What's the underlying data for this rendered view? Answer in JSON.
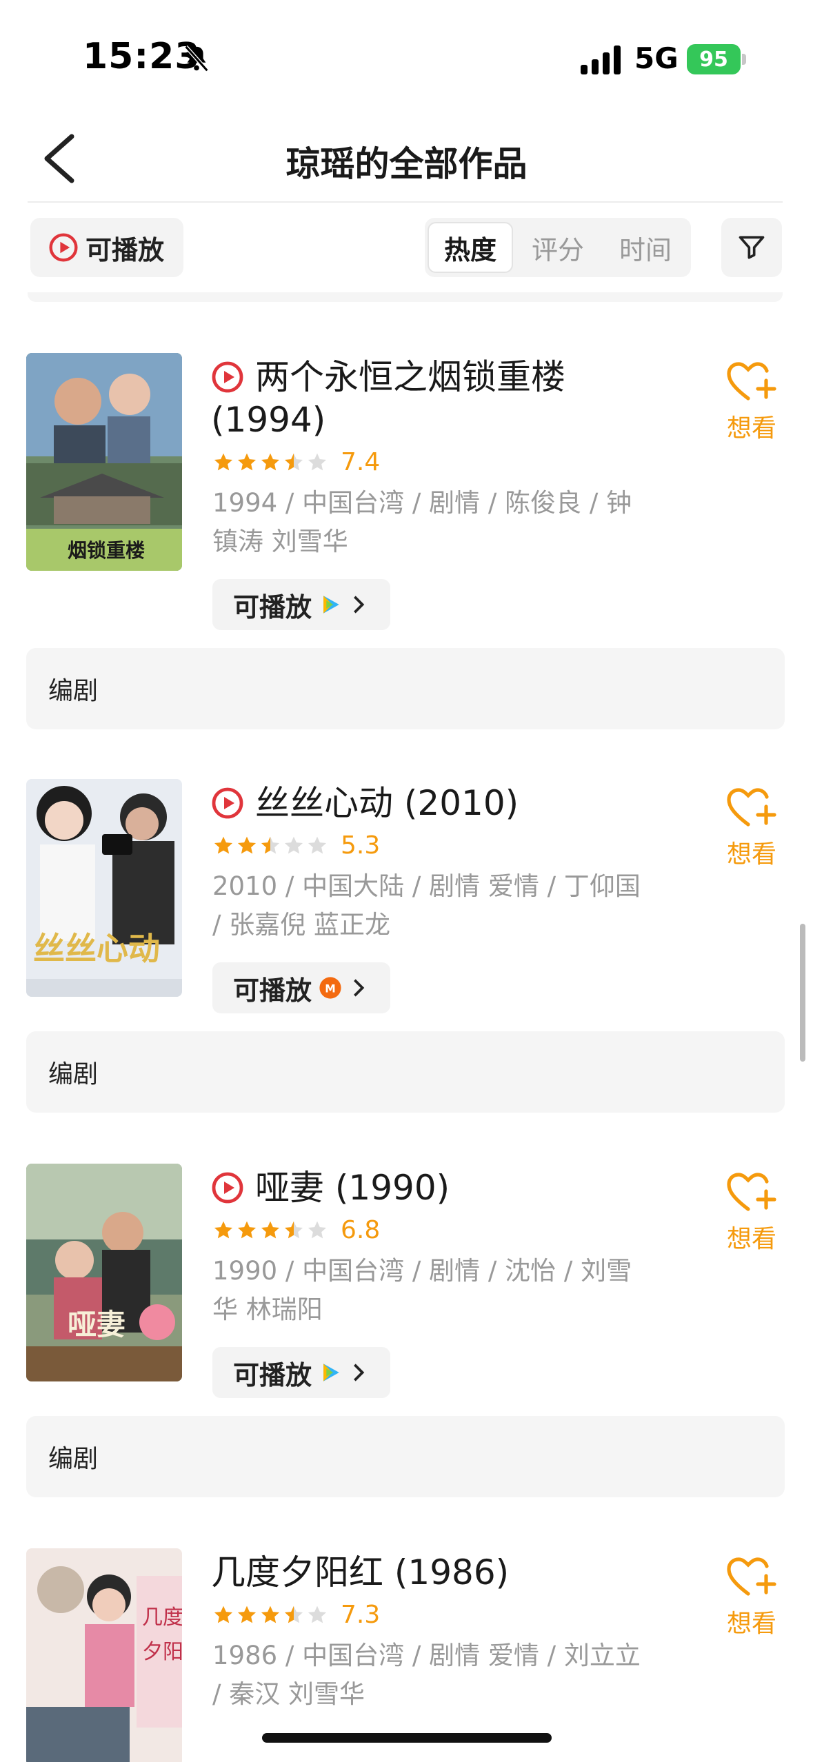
{
  "status_bar": {
    "time": "15:23",
    "network": "5G",
    "battery": "95"
  },
  "nav": {
    "title": "琼瑶的全部作品"
  },
  "filters": {
    "playable": "可播放",
    "sort_tabs": [
      "热度",
      "评分",
      "时间"
    ],
    "active_sort": "热度"
  },
  "films": [
    {
      "title": "两个永恒之烟锁重楼",
      "year": "(1994)",
      "playable_icon": true,
      "rating": 7.4,
      "score": "7.4",
      "meta": "1994 / 中国台湾 / 剧情 / 陈俊良 / 钟镇涛 刘雪华",
      "playable_label": "可播放",
      "source_icon": "tencent-video-icon",
      "want_label": "想看",
      "role": "编剧"
    },
    {
      "title": "丝丝心动",
      "year": "(2010)",
      "playable_icon": true,
      "rating": 5.3,
      "score": "5.3",
      "meta": "2010 / 中国大陆 / 剧情 爱情 / 丁仰国 / 张嘉倪 蓝正龙",
      "playable_label": "可播放",
      "source_icon": "mango-tv-icon",
      "want_label": "想看",
      "role": "编剧"
    },
    {
      "title": "哑妻",
      "year": "(1990)",
      "playable_icon": true,
      "rating": 6.8,
      "score": "6.8",
      "meta": "1990 / 中国台湾 / 剧情 / 沈怡 / 刘雪华 林瑞阳",
      "playable_label": "可播放",
      "source_icon": "tencent-video-icon",
      "want_label": "想看",
      "role": "编剧"
    },
    {
      "title": "几度夕阳红",
      "year": "(1986)",
      "playable_icon": false,
      "rating": 7.3,
      "score": "7.3",
      "meta": "1986 / 中国台湾 / 剧情 爱情 / 刘立立 / 秦汉 刘雪华",
      "want_label": "想看"
    }
  ],
  "colors": {
    "accent": "#f59a0d",
    "play_red": "#e0353b",
    "battery": "#34c759"
  }
}
